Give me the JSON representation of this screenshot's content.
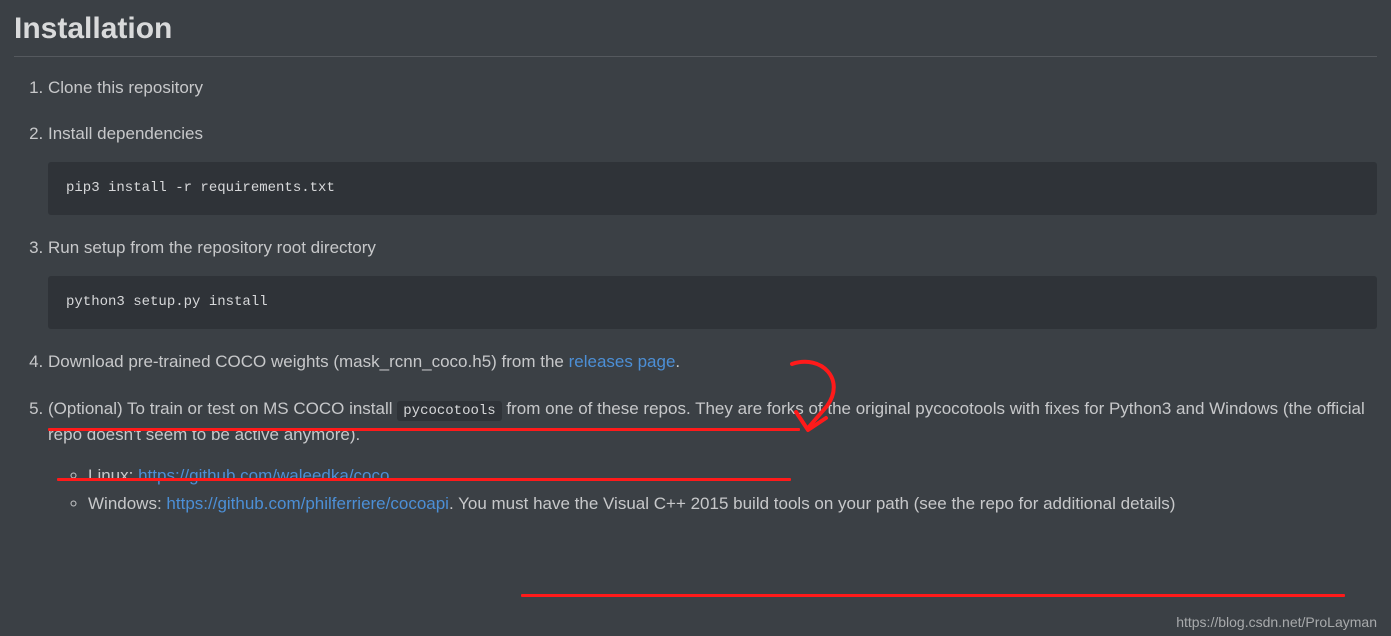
{
  "heading": "Installation",
  "steps": {
    "s1": "Clone this repository",
    "s2": "Install dependencies",
    "code2": "pip3 install -r requirements.txt",
    "s3": "Run setup from the repository root directory",
    "code3": "python3 setup.py install",
    "s4_pre": "Download pre-trained COCO weights (mask_rcnn_coco.h5) from the ",
    "s4_link": "releases page",
    "s4_post": ".",
    "s5_a": "(Optional) To train or test on MS COCO install ",
    "s5_code": "pycocotools",
    "s5_b": " from one of these repos. They are forks of the original pycocotools with fixes for Python3 and Windows (the official repo doesn't seem to be active anymore).",
    "linux_label": "Linux: ",
    "linux_link": "https://github.com/waleedka/coco",
    "windows_label": "Windows: ",
    "windows_link": "https://github.com/philferriere/cocoapi",
    "windows_post": ". You must have the Visual C++ 2015 build tools on your path (see the repo for additional details)"
  },
  "watermark": "https://blog.csdn.net/ProLayman"
}
